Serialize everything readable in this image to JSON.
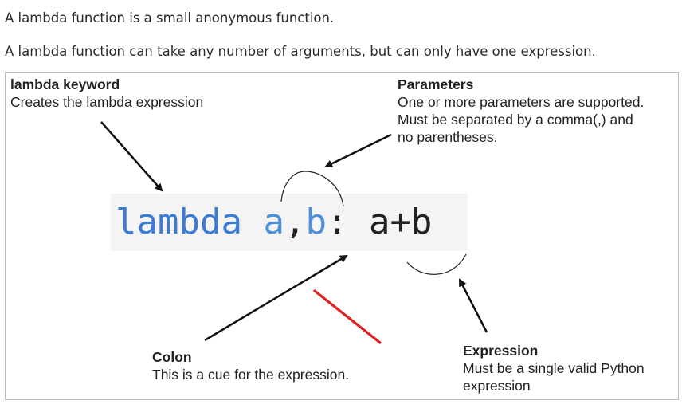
{
  "intro": {
    "line1": "A lambda function is a small anonymous function.",
    "line2": "A lambda function can take any number of arguments, but can only have one expression."
  },
  "code": {
    "keyword": "lambda",
    "param1": "a",
    "comma": ",",
    "param2": "b",
    "colon": ":",
    "expression": "a+b"
  },
  "annotations": {
    "lambda_keyword": {
      "title": "lambda keyword",
      "desc": "Creates the lambda expression"
    },
    "parameters": {
      "title": "Parameters",
      "lines": [
        "One or more parameters are supported.",
        "Must be separated by a comma(,) and",
        "no parentheses."
      ]
    },
    "colon": {
      "title": "Colon",
      "desc": "This is a cue for the expression."
    },
    "expression": {
      "title": "Expression",
      "lines": [
        "Must be a single valid Python",
        "expression"
      ]
    }
  },
  "colors": {
    "keyword": "#3b7bd4",
    "parameters": "#4d8fd9",
    "arrow": "#111111",
    "red_mark": "#e02020",
    "code_background": "#f4f4f4"
  }
}
